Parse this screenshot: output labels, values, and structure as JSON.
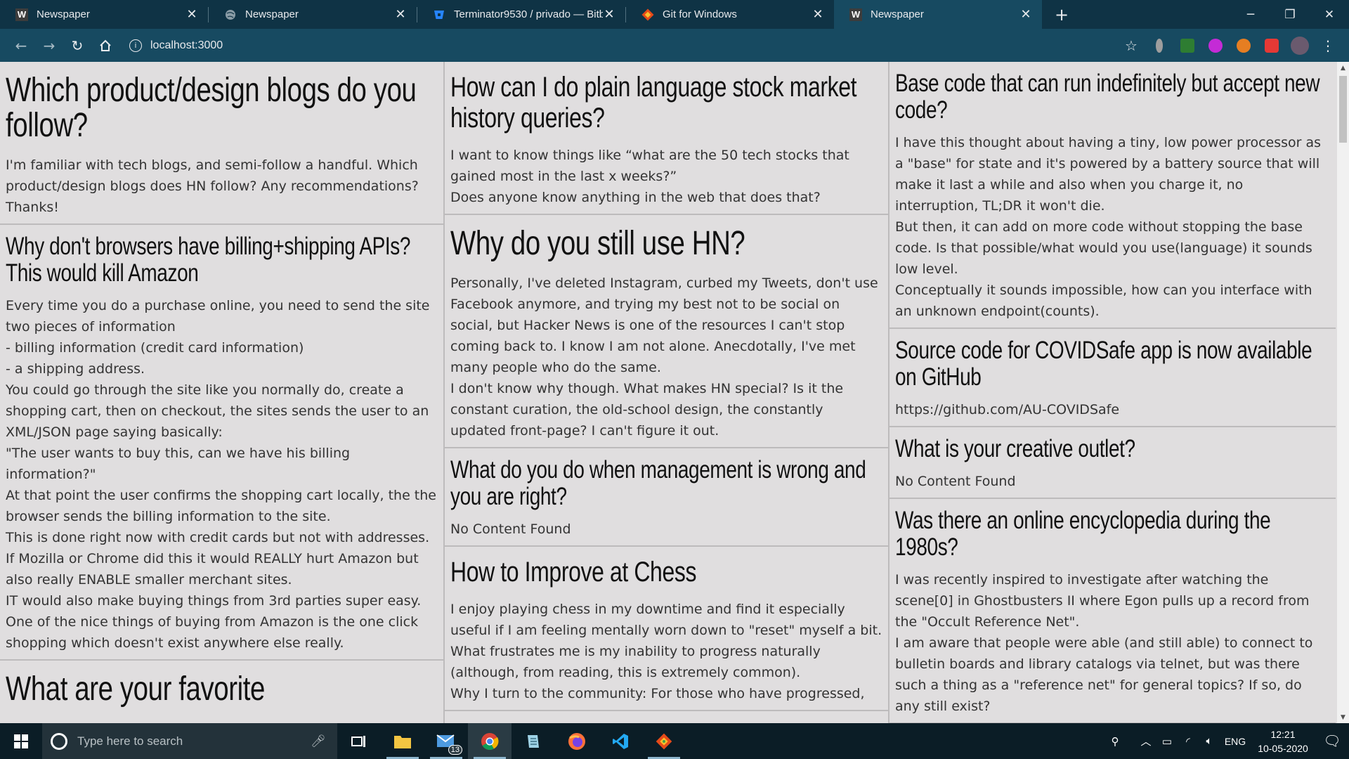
{
  "browser": {
    "tabs": [
      {
        "favicon": "W",
        "title": "Newspaper",
        "active": false
      },
      {
        "favicon": "globe",
        "title": "Newspaper",
        "active": false
      },
      {
        "favicon": "bitbucket",
        "title": "Terminator9530 / privado — Bitb",
        "active": false
      },
      {
        "favicon": "git",
        "title": "Git for Windows",
        "active": false
      },
      {
        "favicon": "W",
        "title": "Newspaper",
        "active": true
      }
    ],
    "url": "localhost:3000",
    "extension_colors": [
      "#9e9e9e",
      "#2e7d32",
      "#c42bd6",
      "#e67e22",
      "#e53935"
    ]
  },
  "columns": [
    [
      {
        "title": "Which product/design blogs do you follow?",
        "size": "xl",
        "body": "I'm familiar with tech blogs, and semi-follow a handful. Which product/design blogs does HN follow? Any recommendations? Thanks!"
      },
      {
        "title": "Why don't browsers have billing+shipping APIs? This would kill Amazon",
        "size": "m",
        "body": "Every time you do a purchase online, you need to send the site two pieces of information\n- billing information (credit card information)\n- a shipping address.\nYou could go through the site like you normally do, create a shopping cart, then on checkout, the sites sends the user to an XML/JSON page saying basically:\n\"The user wants to buy this, can we have his billing information?\"\nAt that point the user confirms the shopping cart locally, the the browser sends the billing information to the site.\nThis is done right now with credit cards but not with addresses.\nIf Mozilla or Chrome did this it would REALLY hurt Amazon but also really ENABLE smaller merchant sites.\nIT would also make buying things from 3rd parties super easy.\nOne of the nice things of buying from Amazon is the one click shopping which doesn't exist anywhere else really."
      },
      {
        "title": "What are your favorite",
        "size": "xl",
        "body": ""
      }
    ],
    [
      {
        "title": "How can I do plain language stock market history queries?",
        "size": "l",
        "body": "I want to know things like “what are the 50 tech stocks that gained most in the last x weeks?”\nDoes anyone know anything in the web that does that?"
      },
      {
        "title": "Why do you still use HN?",
        "size": "xl",
        "body": "Personally, I've deleted Instagram, curbed my Tweets, don't use Facebook anymore, and trying my best not to be social on social, but Hacker News is one of the resources I can't stop coming back to. I know I am not alone. Anecdotally, I've met many people who do the same.\nI don't know why though. What makes HN special? Is it the constant curation, the old-school design, the constantly updated front-page? I can't figure it out."
      },
      {
        "title": "What do you do when management is wrong and you are right?",
        "size": "m",
        "body": "No Content Found"
      },
      {
        "title": "How to Improve at Chess",
        "size": "l",
        "body": "I enjoy playing chess in my downtime and find it especially useful if I am feeling mentally worn down to \"reset\" myself a bit.\nWhat frustrates me is my inability to progress naturally (although, from reading, this is extremely common).\nWhy I turn to the community: For those who have progressed,"
      }
    ],
    [
      {
        "title": "Base code that can run indefinitely but accept new code?",
        "size": "m",
        "body": "I have this thought about having a tiny, low power processor as a \"base\" for state and it's powered by a battery source that will make it last a while and also when you charge it, no interruption, TL;DR it won't die.\nBut then, it can add on more code without stopping the base code. Is that possible/what would you use(language) it sounds low level.\nConceptually it sounds impossible, how can you interface with an unknown endpoint(counts)."
      },
      {
        "title": "Source code for COVIDSafe app is now available on GitHub",
        "size": "m",
        "body": "https://github.com/AU-COVIDSafe"
      },
      {
        "title": "What is your creative outlet?",
        "size": "m",
        "body": "No Content Found"
      },
      {
        "title": "Was there an online encyclopedia during the 1980s?",
        "size": "m",
        "body": "I was recently inspired to investigate after watching the scene[0] in Ghostbusters II where Egon pulls up a record from the \"Occult Reference Net\".\nI am aware that people were able (and still able) to connect to bulletin boards and library catalogs via telnet, but was there such a thing as a \"reference net\" for general topics? If so, do any still exist?"
      }
    ]
  ],
  "taskbar": {
    "search_placeholder": "Type here to search",
    "mail_badge": "13",
    "language": "ENG",
    "time": "12:21",
    "date": "10-05-2020"
  }
}
